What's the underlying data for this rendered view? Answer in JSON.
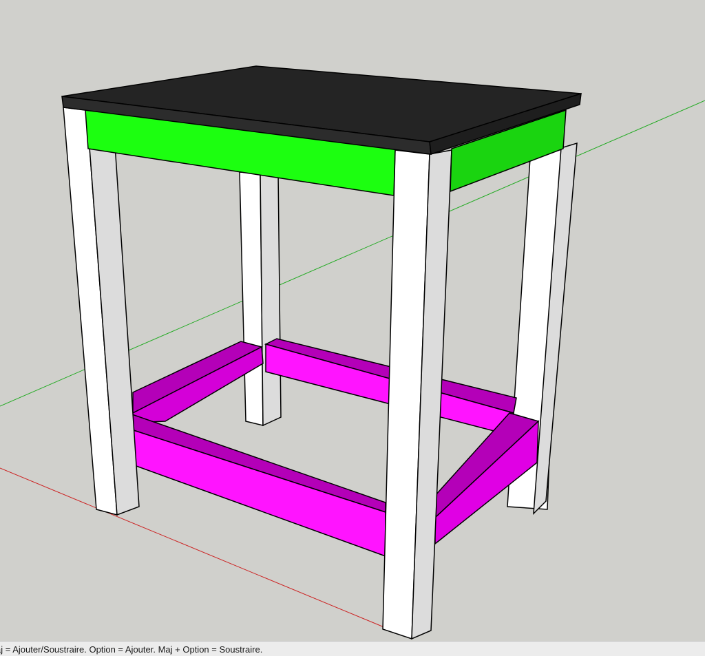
{
  "app": {
    "viewport_background": "#d0d0cc"
  },
  "model": {
    "object": "table",
    "parts": [
      {
        "name": "tabletop",
        "color": "#242424"
      },
      {
        "name": "upper-apron",
        "color": "#1cff10"
      },
      {
        "name": "upper-apron-side",
        "color": "#1ad410"
      },
      {
        "name": "legs",
        "color": "#ffffff"
      },
      {
        "name": "lower-stretchers",
        "color": "#ff14ff"
      },
      {
        "name": "lower-stretchers-shaded",
        "color": "#b400b8"
      }
    ]
  },
  "axes": {
    "green_axis_color": "#22aa22",
    "red_axis_color": "#cc2222"
  },
  "status_bar": {
    "hint": "aj = Ajouter/Soustraire. Option = Ajouter. Maj + Option = Soustraire."
  }
}
